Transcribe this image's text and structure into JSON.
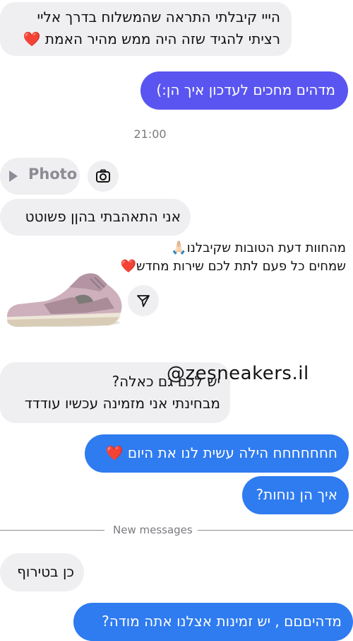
{
  "messages": {
    "m1_line1": "הייי קיבלתי התראה שהמשלוח בדרך אליי",
    "m1_line2": "רציתי להגיד שזה היה ממש מהיר האמת ❤️",
    "m2": "מדהים מחכים לעדכון איך הן:)",
    "time": "21:00",
    "photo_label": "Photo",
    "m3": "אני התאהבתי בהןן פשוטט",
    "story_caption_line1": "מהחוות דעת הטובות שקיבלנו🙏🏻",
    "story_caption_line2": "שמחים כל פעם לתת לכם שירות מחדש❤️",
    "m4_line1": "יש לכם גם כאלה?",
    "m4_line2": "מבחינתי אני מזמינה עכשיו עודדד",
    "watermark": "@zesneakers.il",
    "m5": "חחחחחחח הילה עשית לנו את היום ❤️",
    "m6": "איך הן נוחות?",
    "divider_label": "New messages",
    "m7": "כן בטירוף",
    "m8": "מדהיםםם , יש זמינות אצלנו אתה מודה?"
  },
  "colors": {
    "incoming_bg": "#efeff1",
    "outgoing_purple": "#5a55f0",
    "outgoing_blue": "#2f7bf0"
  },
  "icons": [
    "play-icon",
    "camera-icon",
    "share-send-icon"
  ]
}
